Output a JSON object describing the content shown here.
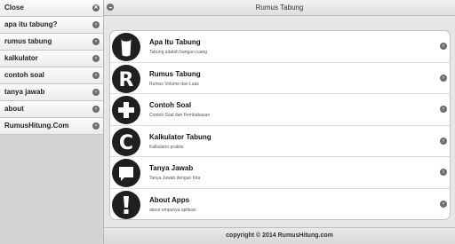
{
  "sidebar": {
    "items": [
      {
        "label": "Close",
        "icon": "close-icon"
      },
      {
        "label": "apa itu tabung?",
        "icon": "chevron-right-icon"
      },
      {
        "label": "rumus tabung",
        "icon": "chevron-right-icon"
      },
      {
        "label": "kalkulator",
        "icon": "chevron-right-icon"
      },
      {
        "label": "contoh soal",
        "icon": "chevron-right-icon"
      },
      {
        "label": "tanya jawab",
        "icon": "chevron-right-icon"
      },
      {
        "label": "about",
        "icon": "chevron-right-icon"
      },
      {
        "label": "RumusHitung.Com",
        "icon": "chevron-right-icon"
      }
    ]
  },
  "header": {
    "title": "Rumus Tabung",
    "menu_icon": "menu-icon"
  },
  "list": {
    "items": [
      {
        "title": "Apa Itu Tabung",
        "subtitle": "Tabung adalah bangun ruang",
        "icon": "cylinder-icon"
      },
      {
        "title": "Rumus Tabung",
        "subtitle": "Rumus Volume dan Luas",
        "icon": "letter-r-icon"
      },
      {
        "title": "Contoh Soal",
        "subtitle": "Contoh Soal dan Pembahasan",
        "icon": "plus-icon"
      },
      {
        "title": "Kalkulator Tabung",
        "subtitle": "Kalkulator praktis",
        "icon": "letter-c-icon"
      },
      {
        "title": "Tanya Jawab",
        "subtitle": "Tanya Jawab dengan Kita",
        "icon": "chat-bubble-icon"
      },
      {
        "title": "About Apps",
        "subtitle": "about empunya aplikasi",
        "icon": "exclamation-icon"
      }
    ]
  },
  "footer": {
    "text": "copyright © 2014 RumusHitung.com"
  }
}
